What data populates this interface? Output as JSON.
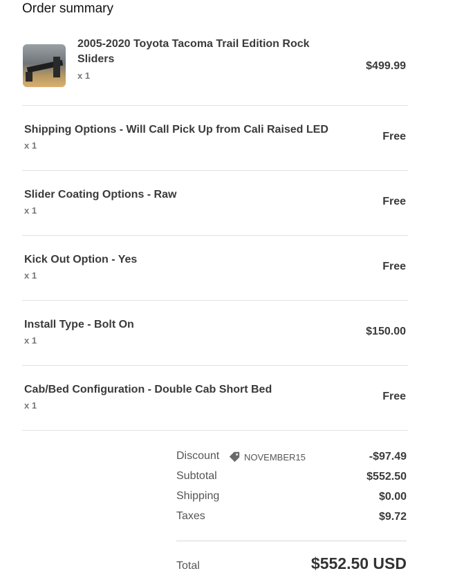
{
  "title": "Order summary",
  "items": [
    {
      "name": "2005-2020 Toyota Tacoma Trail Edition Rock Sliders",
      "qty": "x 1",
      "price": "$499.99",
      "image": "rock-slider-product-photo"
    },
    {
      "name": "Shipping Options - Will Call Pick Up from Cali Raised LED",
      "qty": "x 1",
      "price": "Free"
    },
    {
      "name": "Slider Coating Options - Raw",
      "qty": "x 1",
      "price": "Free"
    },
    {
      "name": "Kick Out Option - Yes",
      "qty": "x 1",
      "price": "Free"
    },
    {
      "name": "Install Type - Bolt On",
      "qty": "x 1",
      "price": "$150.00"
    },
    {
      "name": "Cab/Bed Configuration - Double Cab Short Bed",
      "qty": "x 1",
      "price": "Free"
    }
  ],
  "totals": {
    "discount": {
      "label": "Discount",
      "code": "NOVEMBER15",
      "icon": "tag-icon",
      "value": "-$97.49"
    },
    "subtotal": {
      "label": "Subtotal",
      "value": "$552.50"
    },
    "shipping": {
      "label": "Shipping",
      "value": "$0.00"
    },
    "taxes": {
      "label": "Taxes",
      "value": "$9.72"
    },
    "total": {
      "label": "Total",
      "value": "$552.50 USD"
    }
  }
}
